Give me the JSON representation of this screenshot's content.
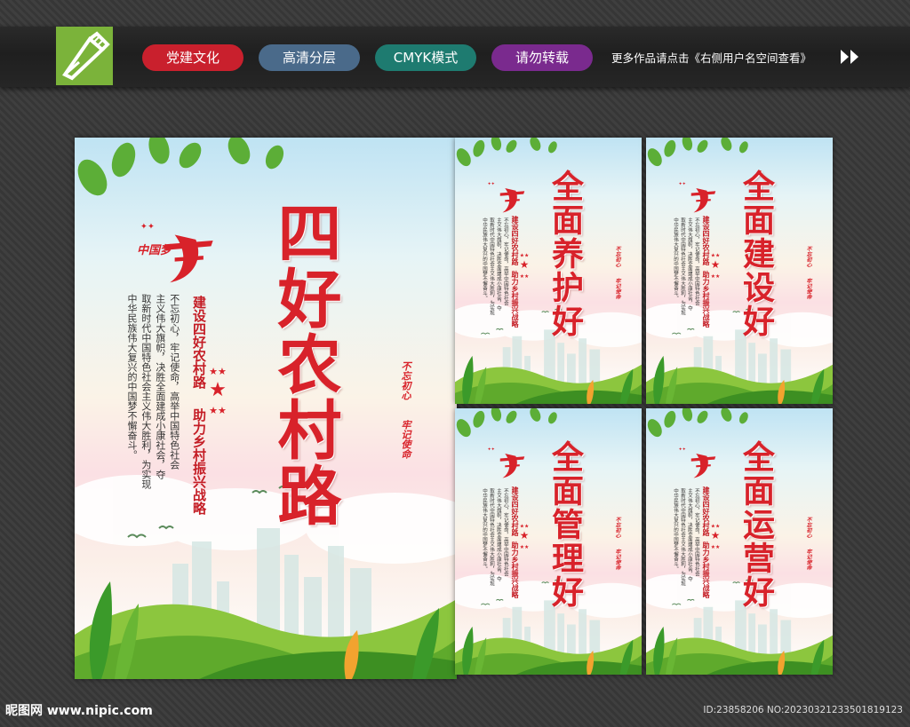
{
  "header": {
    "tags": [
      "党建文化",
      "高清分层",
      "CMYK模式",
      "请勿转载"
    ],
    "more_text": "更多作品请点击《右侧用户名空间查看》",
    "colors": {
      "logo": "#7bb33a",
      "tag1": "#c9202d",
      "tag2": "#4a6a8a",
      "tag3": "#1e7b70",
      "tag4": "#7a2a8e"
    }
  },
  "main_poster": {
    "title": "四好农村路",
    "subtitle_1": "建设四好农村路",
    "subtitle_2": "助力乡村振兴战略",
    "body_lines": [
      "不忘初心，牢记使命，高举中国特色社会",
      "主义伟大旗帜，决胜全面建成小康社会，夺",
      "取新时代中国特色社会主义伟大胜利，为实现",
      "中华民族伟大复兴的中国梦不懈奋斗。"
    ],
    "seal_1": "不忘初心",
    "seal_2": "牢记使命",
    "dream_logo": "中国梦"
  },
  "small_posters": [
    {
      "title": "全面养护好"
    },
    {
      "title": "全面建设好"
    },
    {
      "title": "全面管理好"
    },
    {
      "title": "全面运营好"
    }
  ],
  "footer": {
    "site": "昵图网 www.nipic.com",
    "id_text": "ID:23858206 NO:20230321233501819123"
  }
}
